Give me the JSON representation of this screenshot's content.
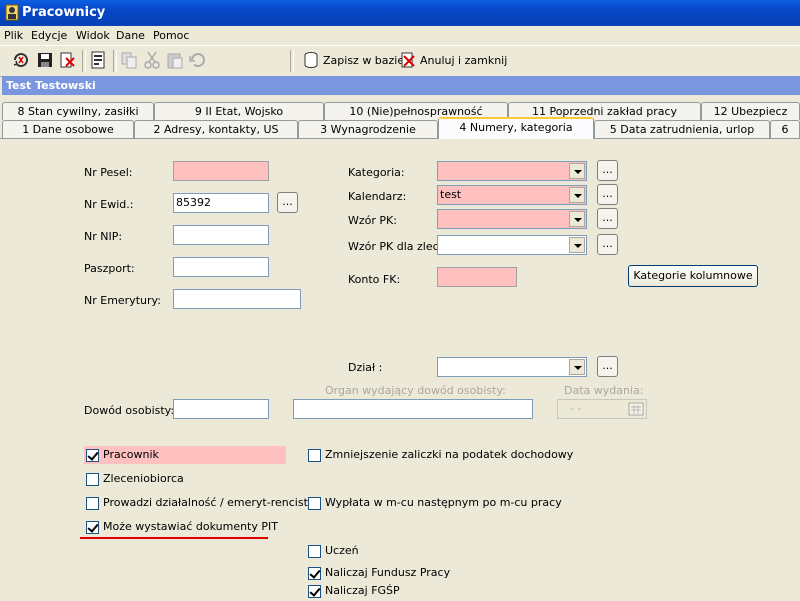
{
  "window": {
    "title": "Pracownicy"
  },
  "menu": [
    "Plik",
    "Edycje",
    "Widok",
    "Dane",
    "Pomoc"
  ],
  "toolbar": {
    "save_label": "Zapisz w bazie",
    "cancel_close_label": "Anuluj i zamknij"
  },
  "header": {
    "employee_name": "Test Testowski"
  },
  "tabs_row1": [
    "8  Stan cywilny, zasiłki",
    "9  II Etat, Wojsko",
    "10  (Nie)pełnosprawność",
    "11  Poprzedni zakład pracy",
    "12  Ubezpiecz"
  ],
  "tabs_row2": [
    "1  Dane osobowe",
    "2  Adresy, kontakty, US",
    "3  Wynagrodzenie",
    "4  Numery, kategoria",
    "5  Data zatrudnienia, urlop",
    "6"
  ],
  "form": {
    "pesel_label": "Nr Pesel:",
    "pesel_value": "",
    "ewid_label": "Nr Ewid.:",
    "ewid_value": "85392",
    "nip_label": "Nr NIP:",
    "nip_value": "",
    "paszport_label": "Paszport:",
    "paszport_value": "",
    "emerytury_label": "Nr Emerytury:",
    "emerytury_value": "",
    "kategoria_label": "Kategoria:",
    "kategoria_value": "",
    "kalendarz_label": "Kalendarz:",
    "kalendarz_value": "test",
    "wzor_pk_label": "Wzór PK:",
    "wzor_pk_value": "",
    "wzor_pk_zlec_label": "Wzór PK dla zlec.:",
    "wzor_pk_zlec_value": "",
    "konto_fk_label": "Konto FK:",
    "konto_fk_value": "",
    "kategorie_kolumnowe_button": "Kategorie kolumnowe",
    "dzial_label": "Dział :",
    "dzial_value": "",
    "organ_label": "Organ wydający dowód osobisty:",
    "organ_value": "",
    "data_wydania_label": "Data wydania:",
    "data_wydania_value": "- -",
    "dowod_label": "Dowód osobisty:",
    "dowod_value": "",
    "ellipsis": "..."
  },
  "checkboxes_left": [
    {
      "label": "Pracownik",
      "checked": true
    },
    {
      "label": "Zleceniobiorca",
      "checked": false
    },
    {
      "label": "Prowadzi działalność / emeryt-rencista",
      "checked": false
    },
    {
      "label": "Może wystawiać dokumenty PIT",
      "checked": true
    }
  ],
  "checkboxes_right": [
    {
      "label": "Zmniejszenie zaliczki na podatek dochodowy",
      "checked": false
    },
    {
      "label": "Wypłata w m-cu następnym po m-cu pracy",
      "checked": false
    },
    {
      "label": "Uczeń",
      "checked": false
    },
    {
      "label": "Naliczaj Fundusz Pracy",
      "checked": true
    },
    {
      "label": "Naliczaj FGŚP",
      "checked": true
    }
  ],
  "colors": {
    "required_field": "#ffc0c0",
    "title_bar": "#0a5fe0",
    "header_strip": "#7a96df",
    "underline": "#e00000"
  }
}
